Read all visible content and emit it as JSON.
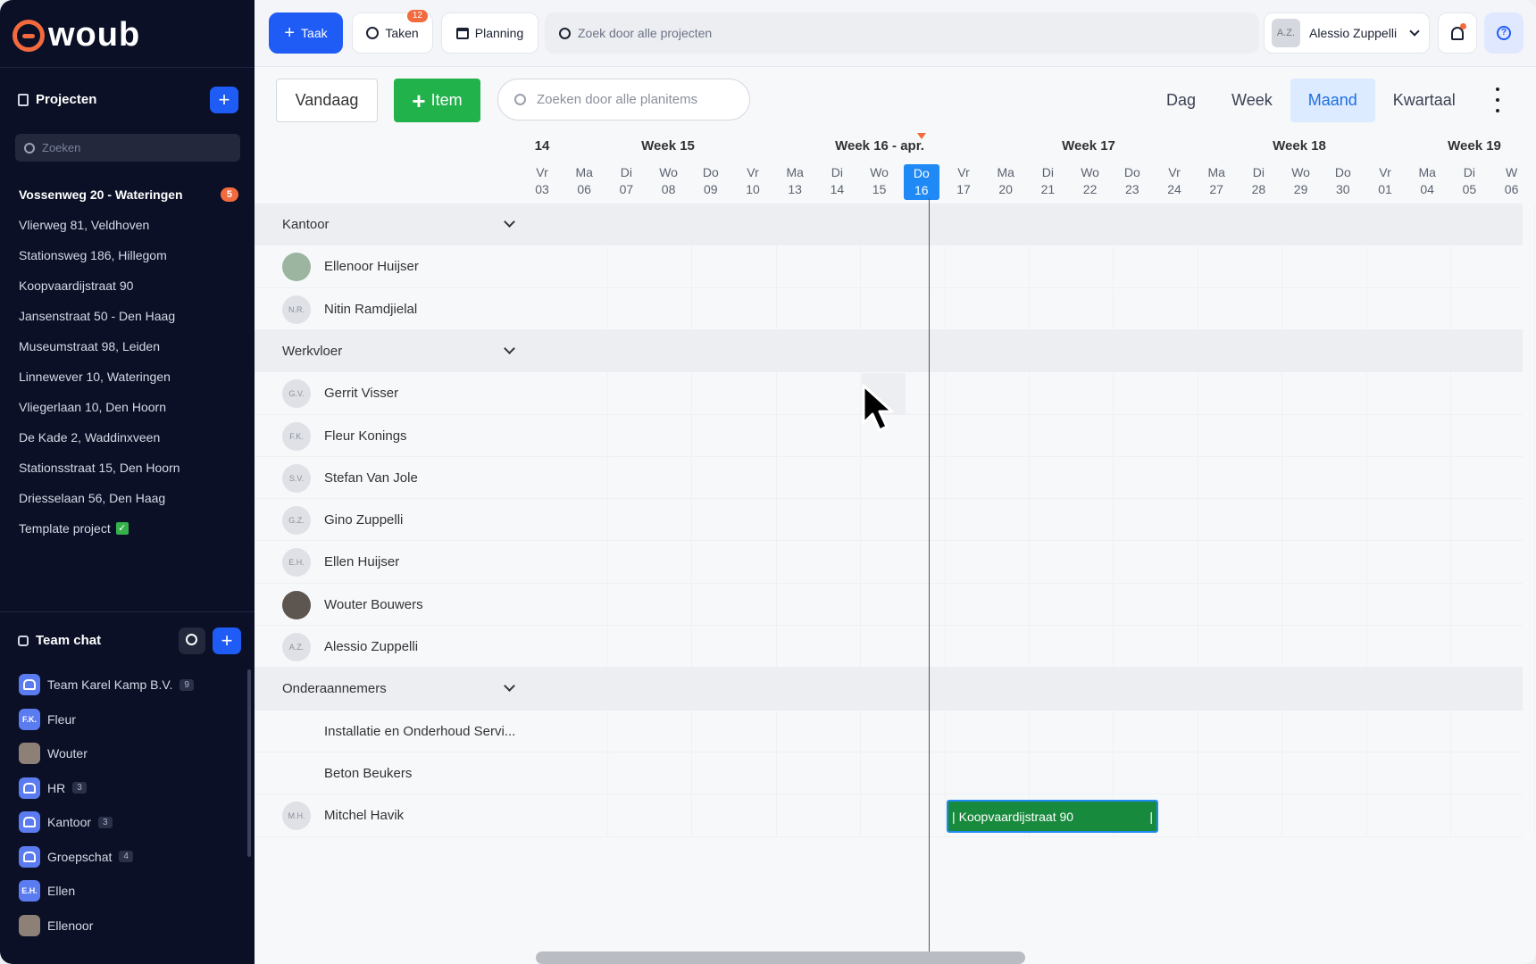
{
  "brand": {
    "logo_text": "woub"
  },
  "sidebar": {
    "projects_title": "Projecten",
    "search_placeholder": "Zoeken",
    "projects": [
      {
        "label": "Vossenweg 20 - Wateringen",
        "badge": "5",
        "active": true
      },
      {
        "label": "Vlierweg 81, Veldhoven"
      },
      {
        "label": "Stationsweg 186, Hillegom"
      },
      {
        "label": "Koopvaardijstraat 90"
      },
      {
        "label": "Jansenstraat 50 - Den Haag"
      },
      {
        "label": "Museumstraat 98, Leiden"
      },
      {
        "label": "Linnewever 10, Wateringen"
      },
      {
        "label": "Vliegerlaan 10, Den Hoorn"
      },
      {
        "label": "De Kade 2, Waddinxveen"
      },
      {
        "label": "Stationsstraat 15, Den Hoorn"
      },
      {
        "label": "Driesselaan 56, Den Haag"
      },
      {
        "label": "Template project",
        "check": "✓"
      }
    ],
    "chat_title": "Team chat",
    "chats": [
      {
        "label": "Team Karel Kamp B.V.",
        "count": "9",
        "avatar": "group"
      },
      {
        "label": "Fleur",
        "avatar": "initials",
        "initials": "F.K."
      },
      {
        "label": "Wouter",
        "avatar": "photo"
      },
      {
        "label": "HR",
        "count": "3",
        "avatar": "group"
      },
      {
        "label": "Kantoor",
        "count": "3",
        "avatar": "group"
      },
      {
        "label": "Groepschat",
        "count": "4",
        "avatar": "group"
      },
      {
        "label": "Ellen",
        "avatar": "initials",
        "initials": "E.H."
      },
      {
        "label": "Ellenoor",
        "avatar": "photo"
      }
    ]
  },
  "topbar": {
    "task_button": "Taak",
    "tasks_button": "Taken",
    "tasks_badge": "12",
    "planning_button": "Planning",
    "search_placeholder": "Zoek door alle projecten",
    "user_initials": "A.Z.",
    "user_name": "Alessio Zuppelli",
    "help_glyph": "?"
  },
  "toolbar": {
    "today_button": "Vandaag",
    "item_button": "Item",
    "search_placeholder": "Zoeken door alle planitems",
    "views": [
      "Dag",
      "Week",
      "Maand",
      "Kwartaal"
    ],
    "active_view": "Maand"
  },
  "timeline": {
    "weeks": [
      "14",
      "Week 15",
      "Week 16 - apr.",
      "Week 17",
      "Week 18",
      "Week 19"
    ],
    "days": [
      {
        "d": "Vr",
        "n": "03"
      },
      {
        "d": "Ma",
        "n": "06"
      },
      {
        "d": "Di",
        "n": "07"
      },
      {
        "d": "Wo",
        "n": "08"
      },
      {
        "d": "Do",
        "n": "09"
      },
      {
        "d": "Vr",
        "n": "10"
      },
      {
        "d": "Ma",
        "n": "13"
      },
      {
        "d": "Di",
        "n": "14"
      },
      {
        "d": "Wo",
        "n": "15"
      },
      {
        "d": "Do",
        "n": "16",
        "today": true
      },
      {
        "d": "Vr",
        "n": "17"
      },
      {
        "d": "Ma",
        "n": "20"
      },
      {
        "d": "Di",
        "n": "21"
      },
      {
        "d": "Wo",
        "n": "22"
      },
      {
        "d": "Do",
        "n": "23"
      },
      {
        "d": "Vr",
        "n": "24"
      },
      {
        "d": "Ma",
        "n": "27"
      },
      {
        "d": "Di",
        "n": "28"
      },
      {
        "d": "Wo",
        "n": "29"
      },
      {
        "d": "Do",
        "n": "30"
      },
      {
        "d": "Vr",
        "n": "01"
      },
      {
        "d": "Ma",
        "n": "04"
      },
      {
        "d": "Di",
        "n": "05"
      },
      {
        "d": "W",
        "n": "06"
      }
    ]
  },
  "rows": [
    {
      "type": "group",
      "label": "Kantoor"
    },
    {
      "type": "person",
      "name": "Ellenoor Huijser",
      "avatar": "photo1"
    },
    {
      "type": "person",
      "name": "Nitin Ramdjielal",
      "initials": "N.R."
    },
    {
      "type": "group",
      "label": "Werkvloer"
    },
    {
      "type": "person",
      "name": "Gerrit Visser",
      "initials": "G.V."
    },
    {
      "type": "person",
      "name": "Fleur Konings",
      "initials": "F.K."
    },
    {
      "type": "person",
      "name": "Stefan Van Jole",
      "initials": "S.V."
    },
    {
      "type": "person",
      "name": "Gino Zuppelli",
      "initials": "G.Z."
    },
    {
      "type": "person",
      "name": "Ellen Huijser",
      "initials": "E.H."
    },
    {
      "type": "person",
      "name": "Wouter Bouwers",
      "avatar": "photo2"
    },
    {
      "type": "person",
      "name": "Alessio Zuppelli",
      "initials": "A.Z."
    },
    {
      "type": "group",
      "label": "Onderaannemers"
    },
    {
      "type": "company",
      "name": "Installatie en Onderhoud Servi..."
    },
    {
      "type": "company",
      "name": "Beton Beukers"
    },
    {
      "type": "person",
      "name": "Mitchel Havik",
      "initials": "M.H."
    }
  ],
  "plan_item": {
    "label": "Koopvaardijstraat 90",
    "handle": "|"
  },
  "colors": {
    "accent": "#1f5bf5",
    "green": "#22b24c",
    "orange": "#f26a3d",
    "sidebar": "#0b1026"
  }
}
